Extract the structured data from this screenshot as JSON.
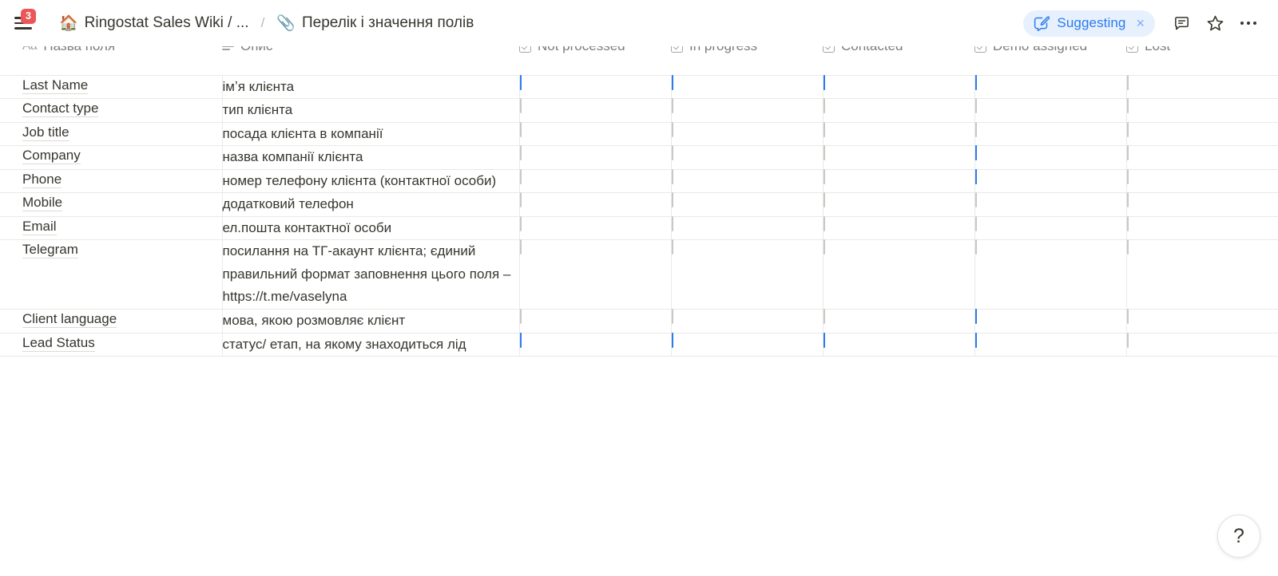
{
  "topbar": {
    "menu_badge_count": "3",
    "breadcrumb": [
      {
        "emoji": "🏠",
        "label": "Ringostat Sales Wiki / ..."
      },
      {
        "emoji": "📎",
        "label": "Перелік і значення полів"
      }
    ],
    "separator": "/",
    "suggesting": {
      "label": "Suggesting",
      "close": "×",
      "pill_bg": "#e7f0fd",
      "text_color": "#2b7cf0"
    },
    "comment_icon": "comment-icon",
    "favorite_icon": "star-icon",
    "more_icon": "more-options-icon"
  },
  "table": {
    "columns": [
      {
        "key": "name",
        "label": "Назва поля",
        "icon": "title-icon",
        "icon_glyph": "Aa"
      },
      {
        "key": "desc",
        "label": "Опис",
        "icon": "text-icon",
        "icon_glyph": ""
      },
      {
        "key": "not_processed",
        "label": "Not processed",
        "icon": "checkbox-icon",
        "icon_glyph": ""
      },
      {
        "key": "in_progress",
        "label": "In progress",
        "icon": "checkbox-icon",
        "icon_glyph": ""
      },
      {
        "key": "contacted",
        "label": "Contacted",
        "icon": "checkbox-icon",
        "icon_glyph": ""
      },
      {
        "key": "demo_assigned",
        "label": "Demo assigned",
        "icon": "checkbox-icon",
        "icon_glyph": ""
      },
      {
        "key": "lost",
        "label": "Lost",
        "icon": "checkbox-icon",
        "icon_glyph": ""
      }
    ],
    "rows": [
      {
        "name": "Last Name",
        "desc": "імʼя клієнта",
        "not_processed": true,
        "in_progress": true,
        "contacted": true,
        "demo_assigned": true,
        "lost": false
      },
      {
        "name": "Contact type",
        "desc": "тип клієнта",
        "not_processed": false,
        "in_progress": false,
        "contacted": false,
        "demo_assigned": false,
        "lost": false
      },
      {
        "name": "Job title",
        "desc": "посада клієнта в компанії",
        "not_processed": false,
        "in_progress": false,
        "contacted": false,
        "demo_assigned": false,
        "lost": false
      },
      {
        "name": "Company",
        "desc": "назва компанії клієнта",
        "not_processed": false,
        "in_progress": false,
        "contacted": false,
        "demo_assigned": true,
        "lost": false
      },
      {
        "name": "Phone",
        "desc": "номер телефону клієнта (контактної особи)",
        "not_processed": false,
        "in_progress": false,
        "contacted": false,
        "demo_assigned": true,
        "lost": false
      },
      {
        "name": "Mobile",
        "desc": "додатковий телефон",
        "not_processed": false,
        "in_progress": false,
        "contacted": false,
        "demo_assigned": false,
        "lost": false
      },
      {
        "name": "Email",
        "desc": "ел.пошта контактної особи",
        "not_processed": false,
        "in_progress": false,
        "contacted": false,
        "demo_assigned": false,
        "lost": false
      },
      {
        "name": "Telegram",
        "desc": "посилання на ТГ-акаунт клієнта; єдиний правильний формат заповнення цього поля – https://t.me/vaselyna",
        "not_processed": false,
        "in_progress": false,
        "contacted": false,
        "demo_assigned": false,
        "lost": false
      },
      {
        "name": "Client language",
        "desc": "мова, якою розмовляє клієнт",
        "not_processed": false,
        "in_progress": false,
        "contacted": false,
        "demo_assigned": true,
        "lost": false
      },
      {
        "name": "Lead Status",
        "desc": "статус/ етап, на якому знаходиться лід",
        "not_processed": true,
        "in_progress": true,
        "contacted": true,
        "demo_assigned": true,
        "lost": false
      }
    ]
  },
  "help": {
    "label": "?"
  },
  "colors": {
    "accent_blue": "#2b7cf0",
    "badge_red": "#eb5757",
    "text": "#37352f",
    "muted_text": "#8b8a87",
    "border": "#eae9e7"
  }
}
